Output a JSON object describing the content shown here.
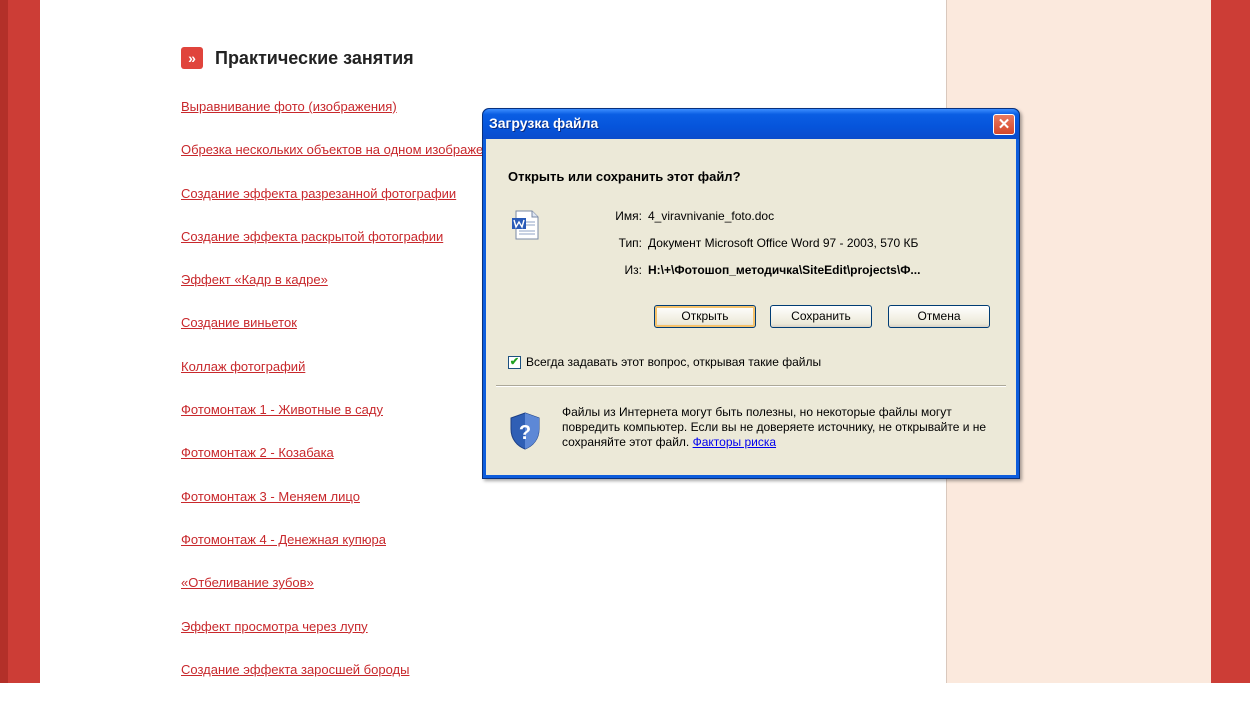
{
  "section": {
    "title": "Практические занятия",
    "icon": "double-chevron-right-icon",
    "icon_glyph": "»"
  },
  "links": [
    "Выравнивание фото (изображения)",
    "Обрезка нескольких объектов на одном изображении",
    "Создание эффекта разрезанной фотографии",
    "Создание эффекта раскрытой фотографии",
    "Эффект «Кадр в кадре»",
    "Создание виньеток",
    "Коллаж фотографий",
    "Фотомонтаж 1 - Животные в саду",
    "Фотомонтаж 2 - Козабака",
    "Фотомонтаж 3 - Меняем лицо ",
    "Фотомонтаж 4 - Денежная купюра",
    "«Отбеливание зубов»",
    "Эффект просмотра через лупу",
    "Создание эффекта заросшей бороды"
  ],
  "dialog": {
    "title": "Загрузка файла",
    "close_glyph": "✕",
    "question": "Открыть или сохранить этот файл?",
    "name_label": "Имя:",
    "name_value": "4_viravnivanie_foto.doc",
    "type_label": "Тип:",
    "type_value": "Документ Microsoft Office Word 97 - 2003, 570 КБ",
    "from_label": "Из:",
    "from_value": "H:\\+\\Фотошоп_методичка\\SiteEdit\\projects\\Ф...",
    "open_button": "Открыть",
    "save_button": "Сохранить",
    "cancel_button": "Отмена",
    "always_ask_checked": true,
    "always_ask_label": "Всегда задавать этот вопрос, открывая такие файлы",
    "warning_text": "Файлы из Интернета могут быть полезны, но некоторые файлы могут повредить компьютер. Если вы не доверяете источнику, не открывайте и не сохраняйте этот файл.",
    "risk_link": "Факторы риска",
    "check_glyph": "✔"
  },
  "colors": {
    "side_band": "#cc3d36",
    "right_panel": "#fbe9dd",
    "link": "#c8282c",
    "dialog_blue": "#0d5ddd",
    "dialog_face": "#ece9d8"
  }
}
